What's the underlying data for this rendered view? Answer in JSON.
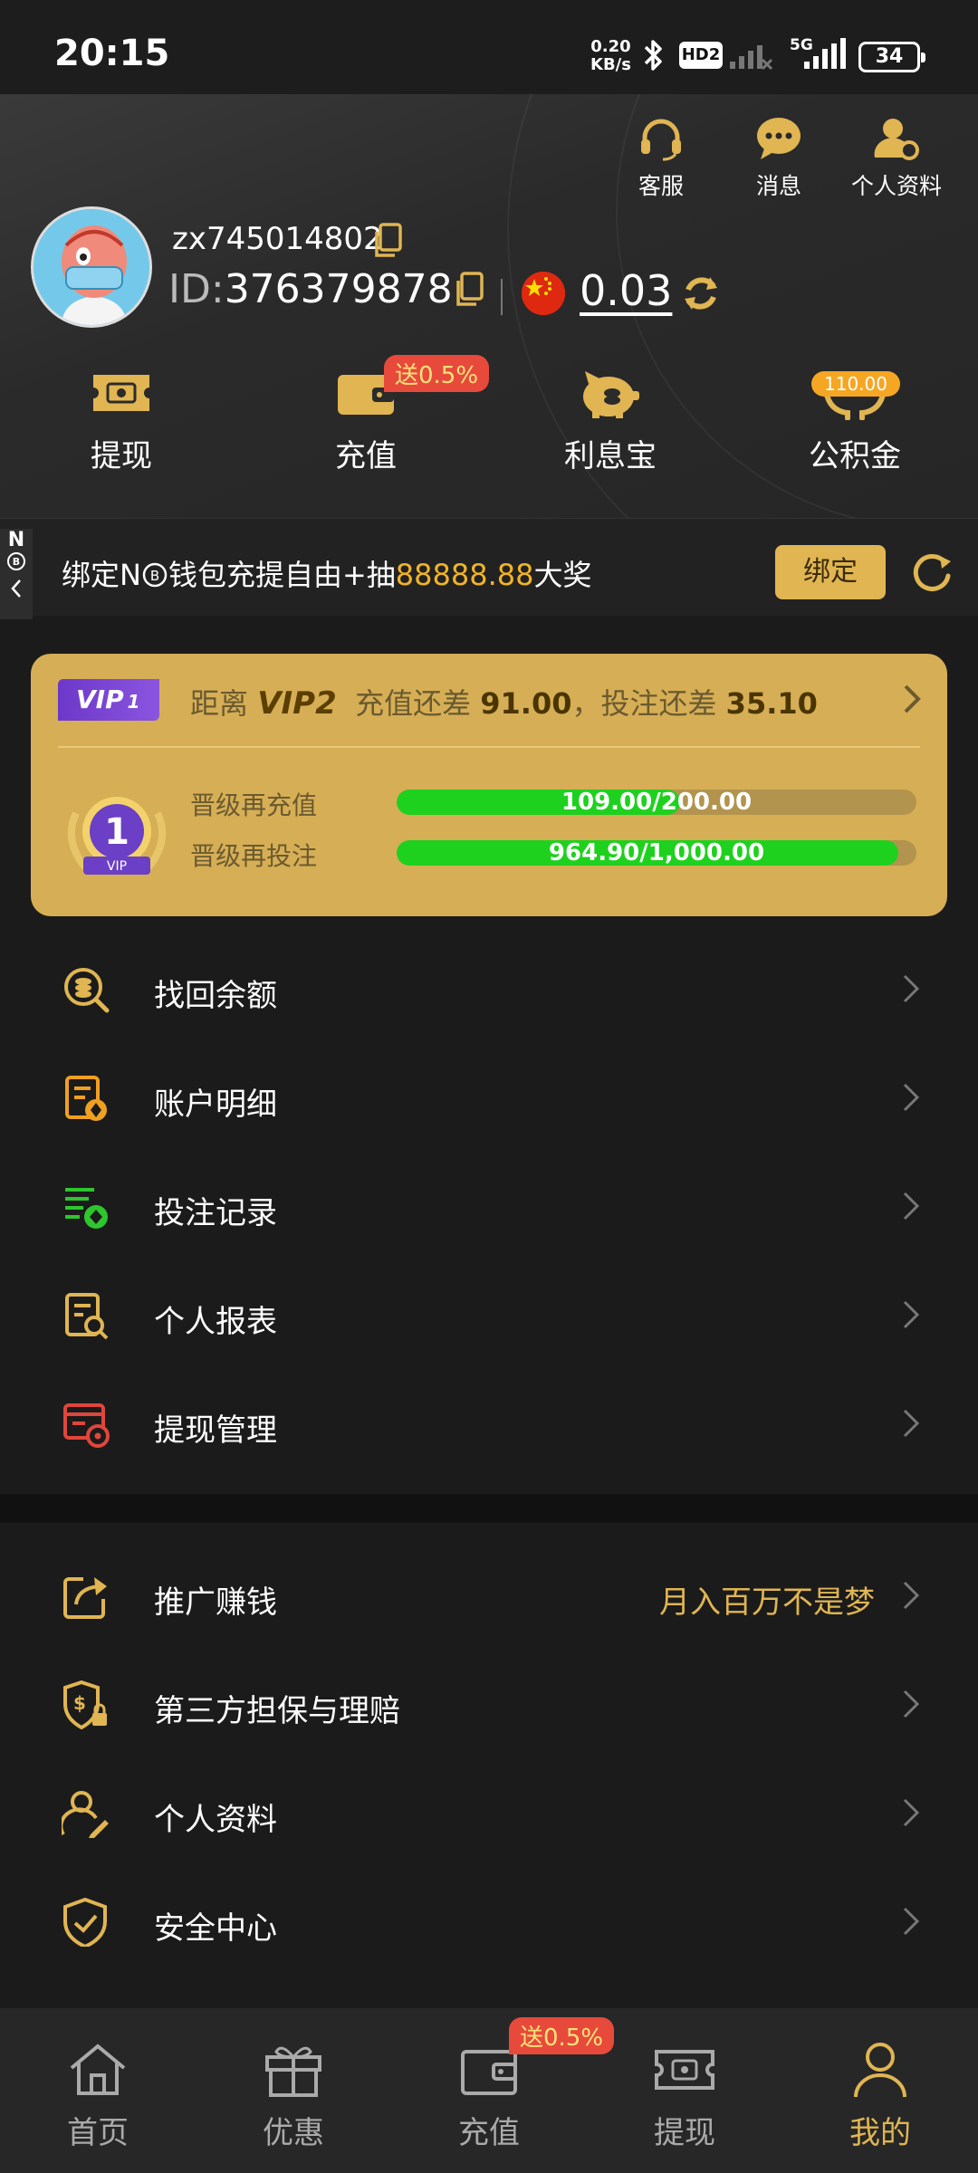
{
  "status_bar": {
    "time": "20:15",
    "net_speed_value": "0.20",
    "net_speed_unit": "KB/s",
    "hd_label": "HD2",
    "network_label": "5G",
    "battery": "34"
  },
  "header": {
    "top_actions": [
      {
        "label": "客服",
        "icon": "headset-icon"
      },
      {
        "label": "消息",
        "icon": "chat-bubble-icon"
      },
      {
        "label": "个人资料",
        "icon": "user-settings-icon"
      }
    ],
    "username": "zx745014802",
    "id_prefix": "ID:",
    "id_value": "376379878",
    "balance": "0.03",
    "quick_actions": [
      {
        "label": "提现",
        "icon": "withdraw-ticket-icon"
      },
      {
        "label": "充值",
        "icon": "wallet-icon",
        "badge": "送0.5%"
      },
      {
        "label": "利息宝",
        "icon": "piggy-bank-icon"
      },
      {
        "label": "公积金",
        "icon": "hands-coin-icon",
        "badge": "110.00"
      }
    ]
  },
  "bind_banner": {
    "side_tab_letter": "N",
    "text_before": "绑定N",
    "text_middle": "钱包充提自由+抽",
    "amount": "88888.88",
    "text_after": "大奖",
    "button_label": "绑定"
  },
  "vip": {
    "current_level_tag": "VIP",
    "current_level_num": "1",
    "distance_prefix": "距离",
    "next_level": "VIP2",
    "recharge_text": "充值还差",
    "recharge_remaining": "91.00",
    "bet_text": "，投注还差",
    "bet_remaining": "35.10",
    "medal_number": "1",
    "medal_caption": "VIP",
    "progress": [
      {
        "label": "晋级再充值",
        "text": "109.00/200.00",
        "fraction": 0.545
      },
      {
        "label": "晋级再投注",
        "text": "964.90/1,000.00",
        "fraction": 0.9649
      }
    ]
  },
  "menu_group1": [
    {
      "label": "找回余额",
      "icon": "search-coin-icon",
      "color": "#e0b552"
    },
    {
      "label": "账户明细",
      "icon": "account-detail-icon",
      "color": "#f0a020"
    },
    {
      "label": "投注记录",
      "icon": "bet-record-icon",
      "color": "#2ec62e"
    },
    {
      "label": "个人报表",
      "icon": "report-search-icon",
      "color": "#e0b552"
    },
    {
      "label": "提现管理",
      "icon": "withdraw-manage-icon",
      "color": "#e0463b"
    }
  ],
  "menu_group2": [
    {
      "label": "推广赚钱",
      "icon": "share-icon",
      "sub": "月入百万不是梦"
    },
    {
      "label": "第三方担保与理赔",
      "icon": "shield-dollar-lock-icon",
      "sub": ""
    },
    {
      "label": "个人资料",
      "icon": "user-edit-icon",
      "sub": ""
    },
    {
      "label": "安全中心",
      "icon": "shield-check-icon",
      "sub": ""
    }
  ],
  "bottom_nav": [
    {
      "label": "首页",
      "icon": "home-icon"
    },
    {
      "label": "优惠",
      "icon": "gift-icon"
    },
    {
      "label": "充值",
      "icon": "wallet-icon",
      "badge": "送0.5%"
    },
    {
      "label": "提现",
      "icon": "withdraw-ticket-icon"
    },
    {
      "label": "我的",
      "icon": "user-icon",
      "active": true
    }
  ],
  "colors": {
    "gold": "#e0b552",
    "vip_card": "#d6ae55",
    "progress_green": "#1fd11f",
    "badge_red": "#e74a3b",
    "badge_orange": "#f5a623"
  }
}
